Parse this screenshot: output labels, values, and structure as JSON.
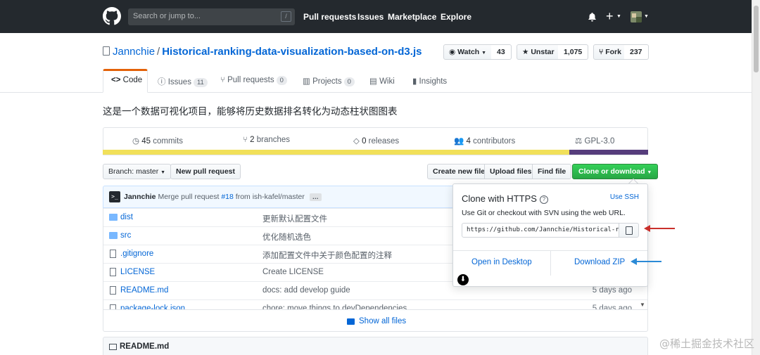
{
  "header": {
    "search_placeholder": "Search or jump to...",
    "search_key": "/",
    "nav": [
      "Pull requests",
      "Issues",
      "Marketplace",
      "Explore"
    ],
    "icons": [
      "bell-icon",
      "plus-icon",
      "avatar"
    ]
  },
  "repo": {
    "owner": "Jannchie",
    "separator": "/",
    "name": "Historical-ranking-data-visualization-based-on-d3.js",
    "watch_label": "Watch",
    "watch_count": "43",
    "unstar_label": "Unstar",
    "star_count": "1,075",
    "fork_label": "Fork",
    "fork_count": "237"
  },
  "tabs": [
    {
      "label": "Code",
      "count": ""
    },
    {
      "label": "Issues",
      "count": "11"
    },
    {
      "label": "Pull requests",
      "count": "0"
    },
    {
      "label": "Projects",
      "count": "0"
    },
    {
      "label": "Wiki",
      "count": ""
    },
    {
      "label": "Insights",
      "count": ""
    }
  ],
  "description": "这是一个数据可视化项目，能够将历史数据排名转化为动态柱状图图表",
  "summary": {
    "commits": "45",
    "commits_label": "commits",
    "branches": "2",
    "branches_label": "branches",
    "releases": "0",
    "releases_label": "releases",
    "contributors": "4",
    "contributors_label": "contributors",
    "license": "GPL-3.0"
  },
  "languages": {
    "js_color": "#f1e05a",
    "css_color": "#563d7c",
    "js_share": 0.856
  },
  "toolbar": {
    "branch_label": "Branch: master",
    "new_pr": "New pull request",
    "create_file": "Create new file",
    "upload_files": "Upload files",
    "find_file": "Find file",
    "clone_download": "Clone or download"
  },
  "commit": {
    "author": "Jannchie",
    "message_prefix": "Merge pull request",
    "pr": "#18",
    "message_suffix": "from ish-kafel/master",
    "ellipsis": "…"
  },
  "files": [
    {
      "type": "dir",
      "name": "dist",
      "message": "更新默认配置文件",
      "age": ""
    },
    {
      "type": "dir",
      "name": "src",
      "message": "优化随机选色",
      "age": ""
    },
    {
      "type": "file",
      "name": ".gitignore",
      "message": "添加配置文件中关于颜色配置的注释",
      "age": ""
    },
    {
      "type": "file",
      "name": "LICENSE",
      "message": "Create LICENSE",
      "age": ""
    },
    {
      "type": "file",
      "name": "README.md",
      "message": "docs: add develop guide",
      "age": "5 days ago"
    },
    {
      "type": "file",
      "name": "package-lock.json",
      "message": "chore: move things to devDependencies",
      "age": "5 days ago"
    }
  ],
  "show_all": "Show all files",
  "readme_label": "README.md",
  "clone": {
    "title": "Clone with HTTPS",
    "help": "?",
    "use_ssh": "Use SSH",
    "subtitle": "Use Git or checkout with SVN using the web URL.",
    "url": "https://github.com/Jannchie/Historical-r",
    "open_desktop": "Open in Desktop",
    "download_zip": "Download ZIP"
  },
  "annotations": {
    "red_arrow_color": "#c9302c",
    "blue_arrow_color": "#2b8ad6"
  },
  "watermark": "@稀土掘金技术社区"
}
